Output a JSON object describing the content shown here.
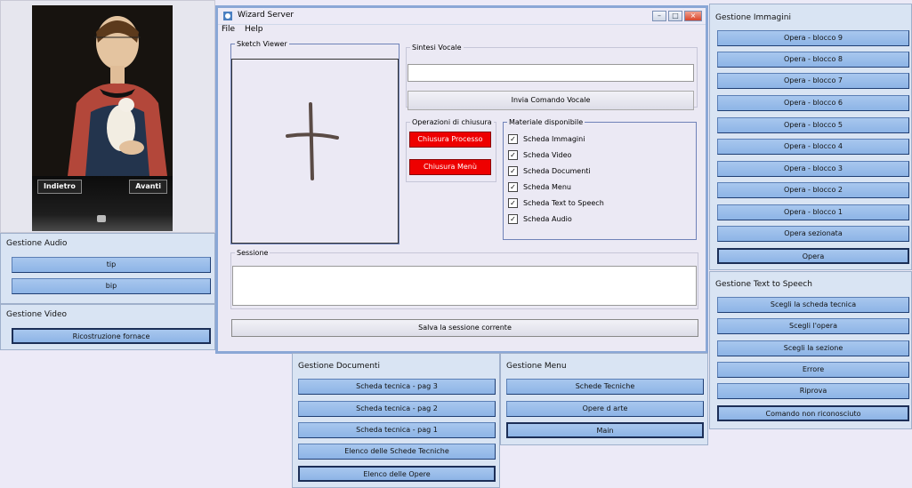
{
  "image_viewer": {
    "back_label": "Indietro",
    "next_label": "Avanti"
  },
  "audio": {
    "title": "Gestione Audio",
    "buttons": [
      "tip",
      "bip"
    ]
  },
  "video": {
    "title": "Gestione Video",
    "buttons": [
      "Ricostruzione fornace"
    ]
  },
  "wizard": {
    "title": "Wizard Server",
    "menu": [
      "File",
      "Help"
    ],
    "sketch_label": "Sketch Viewer",
    "voice_label": "Sintesi Vocale",
    "voice_input_value": "",
    "voice_send_label": "Invia Comando Vocale",
    "closing_label": "Operazioni di chiusura",
    "close_process_label": "Chiusura Processo",
    "close_menu_label": "Chiusura Menù",
    "material_label": "Materiale disponibile",
    "materials": [
      "Scheda Immagini",
      "Scheda Video",
      "Scheda Documenti",
      "Scheda Menu",
      "Scheda Text to Speech",
      "Scheda Audio"
    ],
    "session_label": "Sessione",
    "session_value": "",
    "save_session_label": "Salva la sessione corrente"
  },
  "images": {
    "title": "Gestione Immagini",
    "buttons": [
      "Opera - blocco 9",
      "Opera - blocco 8",
      "Opera - blocco 7",
      "Opera - blocco 6",
      "Opera - blocco 5",
      "Opera - blocco 4",
      "Opera - blocco 3",
      "Opera - blocco 2",
      "Opera - blocco 1",
      "Opera sezionata",
      "Opera"
    ]
  },
  "tts": {
    "title": "Gestione Text to Speech",
    "buttons": [
      "Scegli la scheda tecnica",
      "Scegli l'opera",
      "Scegli la sezione",
      "Errore",
      "Riprova",
      "Comando non riconosciuto"
    ]
  },
  "documents": {
    "title": "Gestione Documenti",
    "buttons": [
      "Scheda tecnica - pag 3",
      "Scheda tecnica - pag 2",
      "Scheda tecnica - pag 1",
      "Elenco delle Schede Tecniche",
      "Elenco delle Opere"
    ]
  },
  "menus": {
    "title": "Gestione Menu",
    "buttons": [
      "Schede Tecniche",
      "Opere d arte",
      "Main"
    ]
  }
}
